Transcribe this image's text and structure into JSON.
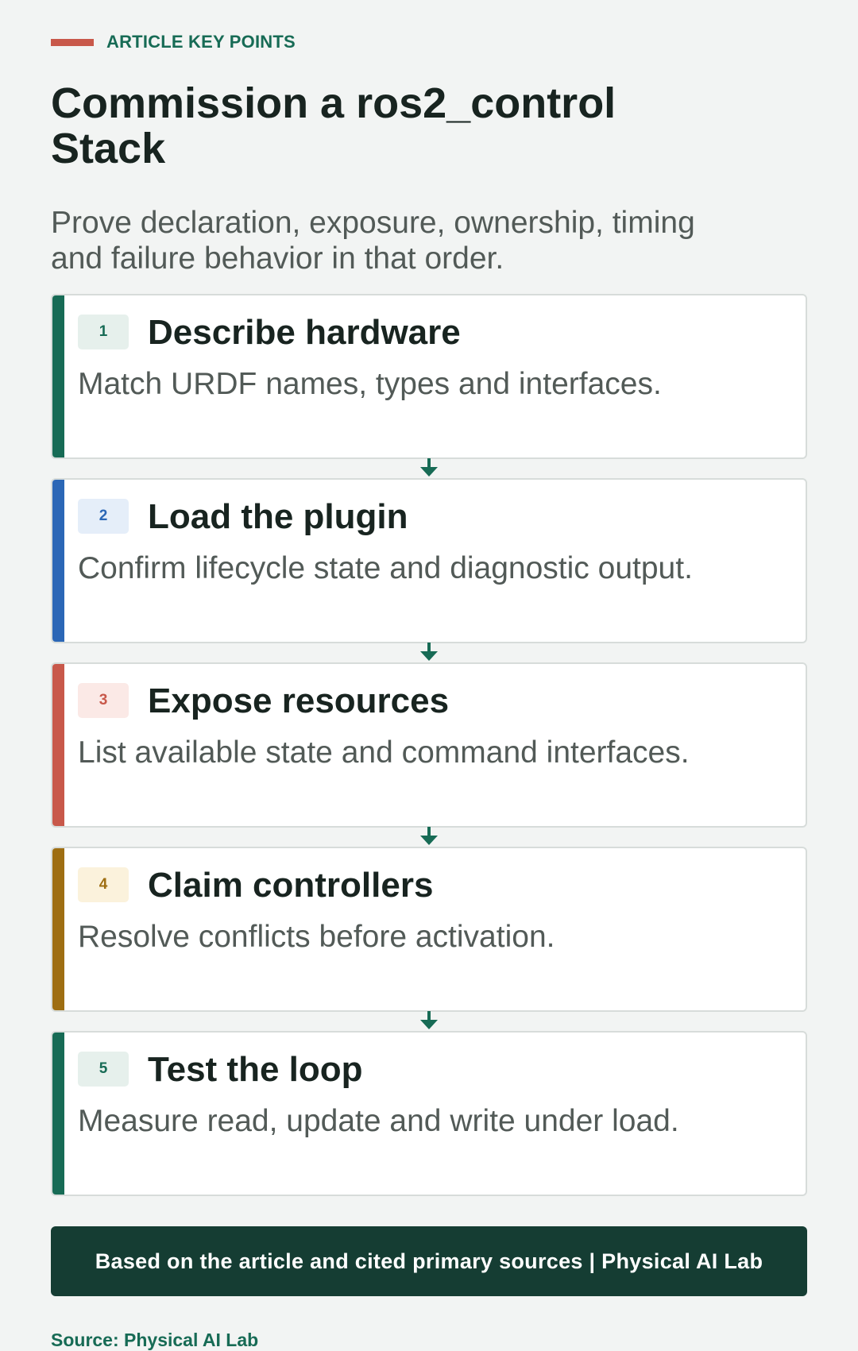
{
  "header": {
    "eyebrow": "ARTICLE KEY POINTS",
    "title": "Commission a ros2_control Stack",
    "subtitle": "Prove declaration, exposure, ownership, timing and failure behavior in that order."
  },
  "steps": [
    {
      "number": "1",
      "title": "Describe hardware",
      "description": "Match URDF names, types and interfaces.",
      "color": "#176b55"
    },
    {
      "number": "2",
      "title": "Load the plugin",
      "description": "Confirm lifecycle state and diagnostic output.",
      "color": "#2b67b6"
    },
    {
      "number": "3",
      "title": "Expose resources",
      "description": "List available state and command interfaces.",
      "color": "#c8584a"
    },
    {
      "number": "4",
      "title": "Claim controllers",
      "description": "Resolve conflicts before activation.",
      "color": "#9e6e12"
    },
    {
      "number": "5",
      "title": "Test the loop",
      "description": "Measure read, update and write under load.",
      "color": "#176b55"
    }
  ],
  "connector_icon": "arrow-down-icon",
  "footer": {
    "banner": "Based on the article and cited primary sources | Physical AI Lab",
    "source": "Source: Physical AI Lab"
  },
  "colors": {
    "background": "#f2f4f3",
    "title": "#182420",
    "body_text": "#525a57",
    "footer_bg": "#153d33",
    "connector": "#176b55"
  }
}
